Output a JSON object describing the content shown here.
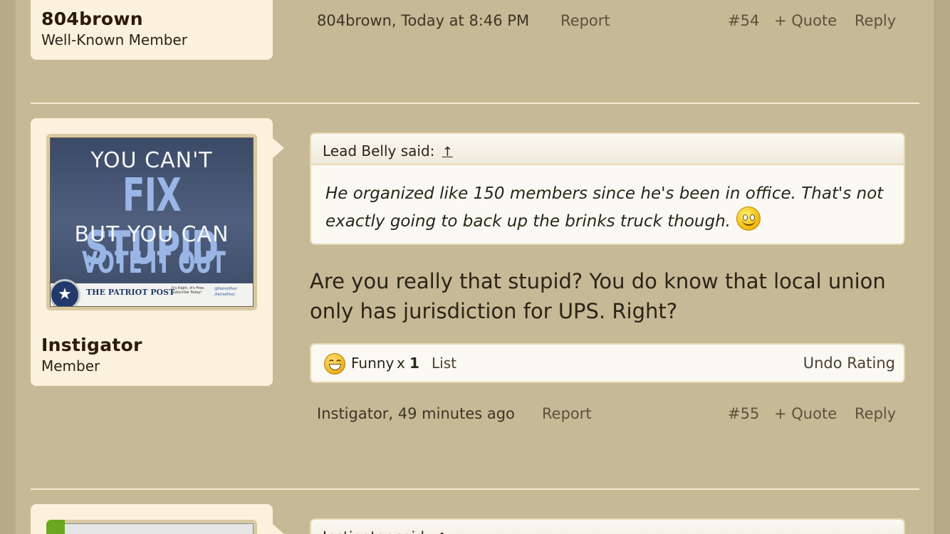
{
  "colors": {
    "page": "#c6b996",
    "userbox": "#fbf1dc",
    "accent_green": "#6aa820"
  },
  "post54": {
    "username": "804brown",
    "user_title": "Well-Known Member",
    "meta": {
      "author_time": "804brown, Today at 8:46 PM",
      "report": "Report",
      "number": "#54",
      "quote": "+ Quote",
      "reply": "Reply"
    }
  },
  "post55": {
    "avatar": {
      "line1": "YOU CAN'T",
      "line2": "FIX STUPID",
      "line3": "BUT YOU CAN",
      "line4": "VOTE IT OUT OF OFFICE",
      "brand": "THE PATRIOT POST",
      "tagline": "It's Right. It's Free. Subscribe Today!",
      "social": "@PatriotPost /PatriotPost"
    },
    "username": "Instigator",
    "user_title": "Member",
    "quote": {
      "header": "Lead Belly said:",
      "jump_icon": "↑",
      "body": "He organized like 150 members since he's been in office. That's not exactly going to back up the brinks truck though."
    },
    "message": "Are you really that stupid? You do know that local union only has jurisdiction for UPS. Right?",
    "rating": {
      "label": "Funny",
      "times": "x",
      "count": "1",
      "list": "List",
      "undo": "Undo Rating"
    },
    "meta": {
      "author_time": "Instigator, 49 minutes ago",
      "report": "Report",
      "number": "#55",
      "quote": "+ Quote",
      "reply": "Reply"
    }
  },
  "post56": {
    "quote_header": "Instigator said:",
    "jump_icon": "↑"
  }
}
